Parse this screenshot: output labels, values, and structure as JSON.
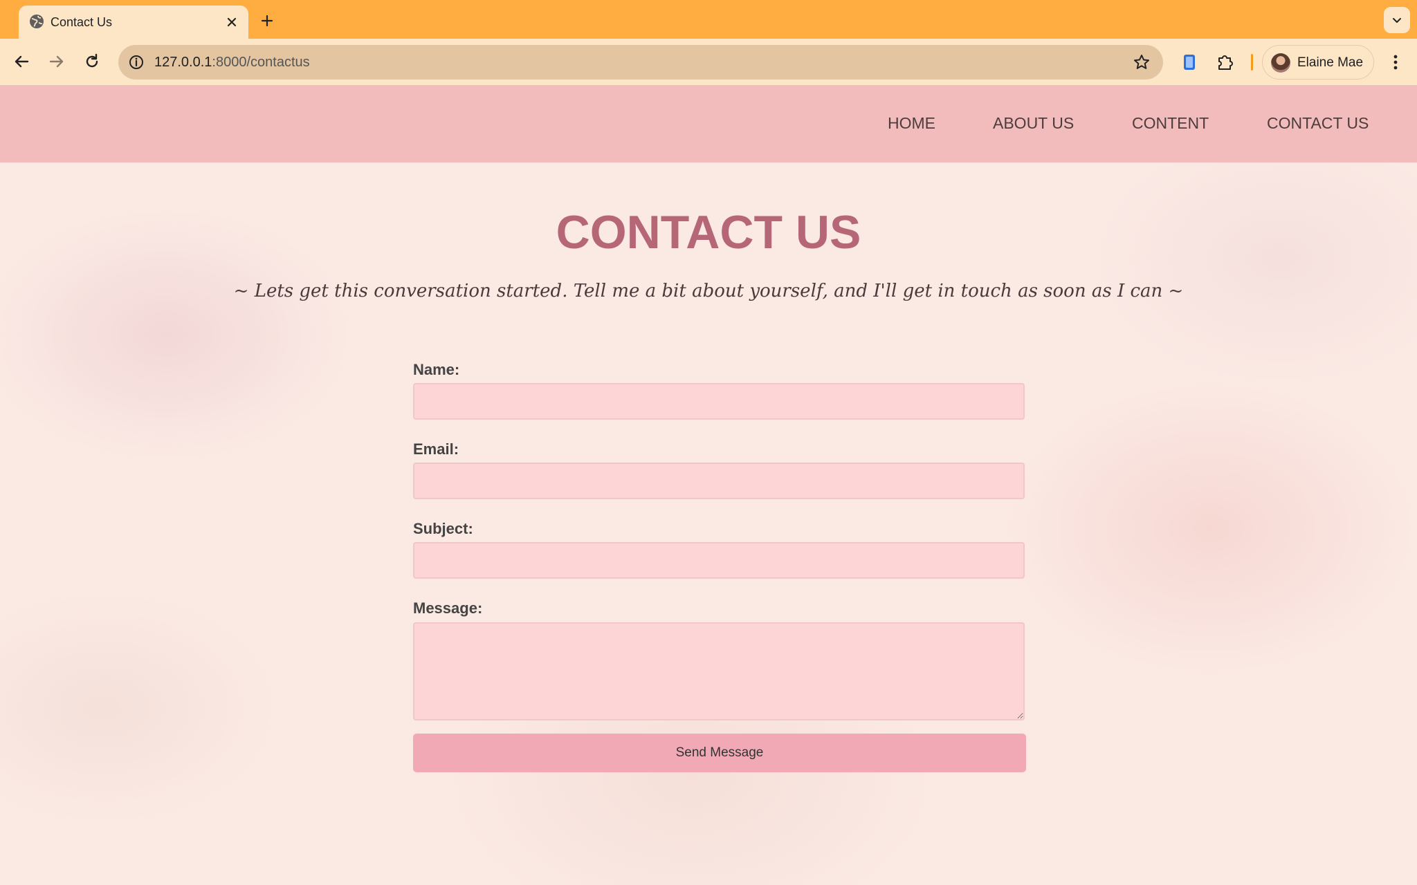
{
  "browser": {
    "tab_title": "Contact Us",
    "url_host": "127.0.0.1",
    "url_path": ":8000/contactus",
    "profile_name": "Elaine Mae",
    "accent_color": "#ffad40"
  },
  "site": {
    "nav": [
      {
        "label": "HOME"
      },
      {
        "label": "ABOUT US"
      },
      {
        "label": "CONTENT"
      },
      {
        "label": "CONTACT US"
      }
    ]
  },
  "main": {
    "title": "CONTACT US",
    "tagline": "~ Lets get this conversation started. Tell me a bit about yourself, and I'll get in touch as soon as I can ~",
    "title_color": "#b56677"
  },
  "form": {
    "name_label": "Name:",
    "name_value": "",
    "email_label": "Email:",
    "email_value": "",
    "subject_label": "Subject:",
    "subject_value": "",
    "message_label": "Message:",
    "message_value": "",
    "submit_label": "Send Message"
  }
}
